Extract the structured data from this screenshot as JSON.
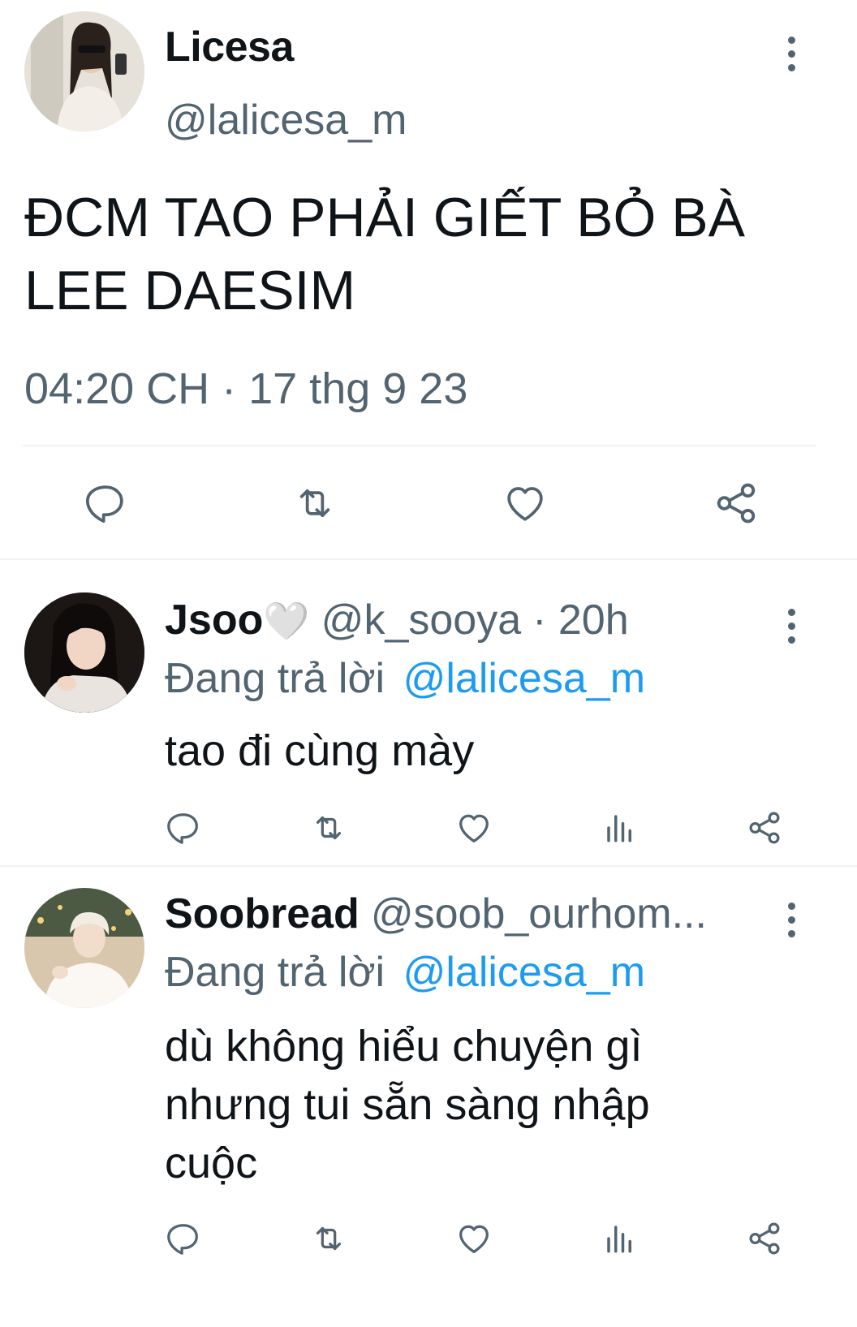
{
  "main_tweet": {
    "display_name": "Licesa",
    "handle": "@lalicesa_m",
    "text_line1": "ĐCM TAO PHẢI GIẾT BỎ BÀ",
    "text_line2": "LEE DAESIM",
    "timestamp": "04:20 CH · 17 thg 9 23",
    "actions": [
      "reply-icon",
      "retweet-icon",
      "like-icon",
      "share-icon"
    ]
  },
  "replies": [
    {
      "display_name": "Jsoo",
      "emoji": "🤍",
      "handle": "@k_sooya",
      "time": "· 20h",
      "replying_prefix": "Đang trả lời",
      "replying_to": "@lalicesa_m",
      "text_lines": [
        "tao đi cùng mày"
      ]
    },
    {
      "display_name": "Soobread",
      "handle": "@soob_ourhom...",
      "replying_prefix": "Đang trả lời",
      "replying_to": "@lalicesa_m",
      "text_lines": [
        "dù không hiểu chuyện gì",
        "nhưng tui sẵn sàng nhập",
        "cuộc"
      ]
    }
  ],
  "colors": {
    "text": "#0f1419",
    "muted": "#536471",
    "link": "#1d9bf0",
    "divider": "#eff3f4"
  }
}
